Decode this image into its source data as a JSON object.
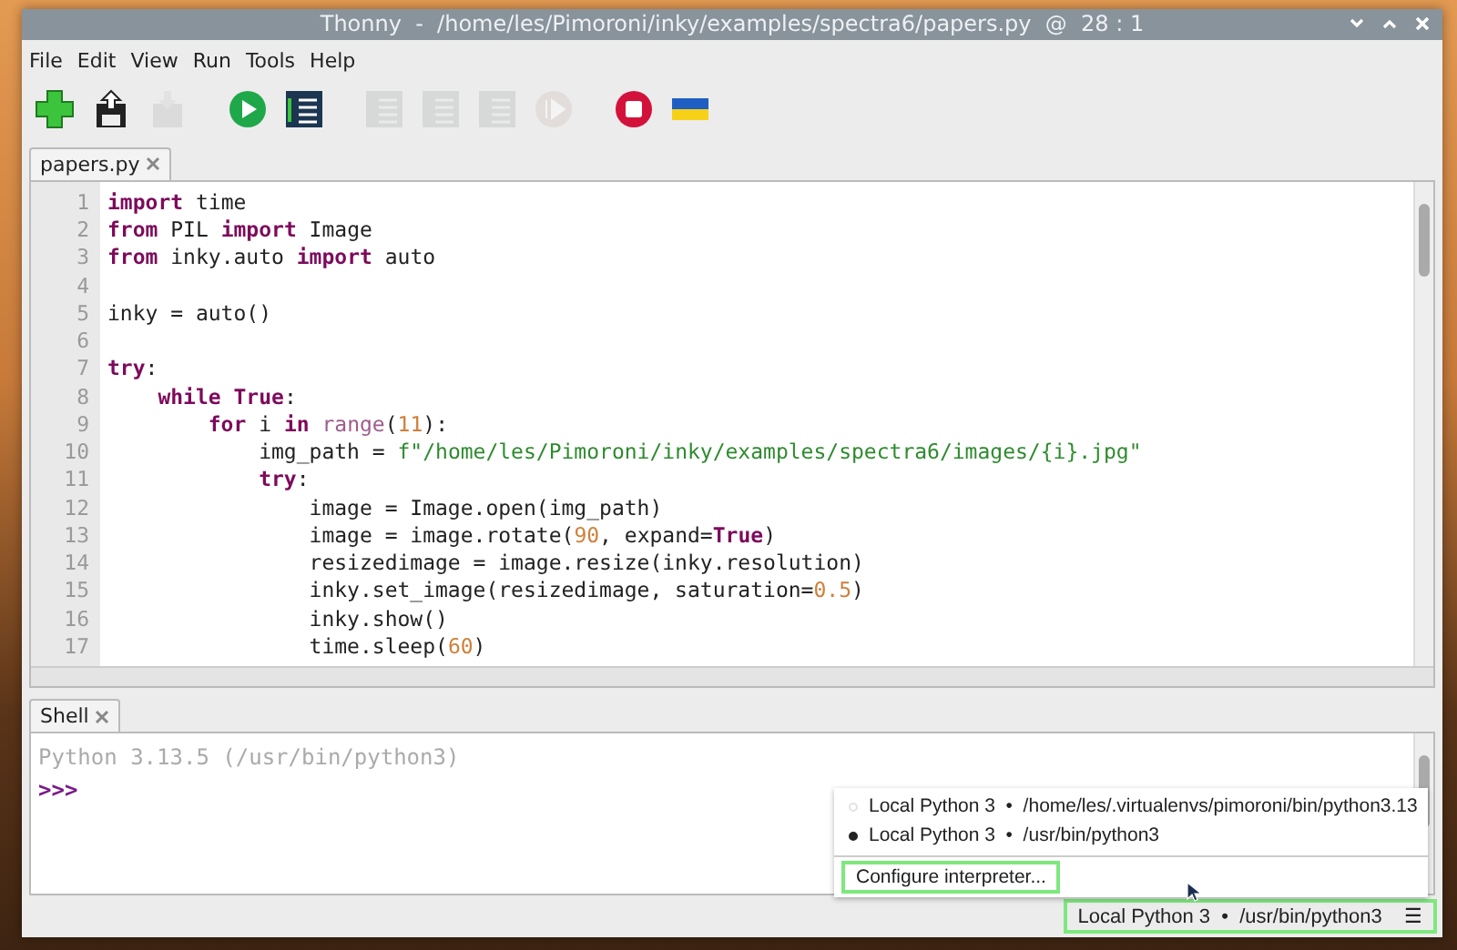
{
  "window": {
    "title": "Thonny  -  /home/les/Pimoroni/inky/examples/spectra6/papers.py  @  28 : 1"
  },
  "menu": [
    "File",
    "Edit",
    "View",
    "Run",
    "Tools",
    "Help"
  ],
  "toolbar": [
    {
      "kind": "new",
      "disabled": false
    },
    {
      "kind": "load",
      "disabled": false
    },
    {
      "kind": "save",
      "disabled": true
    },
    {
      "kind": "run",
      "disabled": false
    },
    {
      "kind": "debug",
      "disabled": false
    },
    {
      "kind": "step-over",
      "disabled": true
    },
    {
      "kind": "step-into",
      "disabled": true
    },
    {
      "kind": "step-out",
      "disabled": true
    },
    {
      "kind": "resume",
      "disabled": true
    },
    {
      "kind": "stop",
      "disabled": false
    },
    {
      "kind": "flag",
      "disabled": false
    }
  ],
  "editor": {
    "tabs": [
      {
        "label": "papers.py",
        "selected": true
      }
    ],
    "lines": [
      {
        "number": "1",
        "tokens": [
          {
            "kind": "kw",
            "text": "import"
          },
          {
            "kind": "plain",
            "text": " time"
          }
        ]
      },
      {
        "number": "2",
        "tokens": [
          {
            "kind": "kw",
            "text": "from"
          },
          {
            "kind": "plain",
            "text": " PIL "
          },
          {
            "kind": "kw",
            "text": "import"
          },
          {
            "kind": "plain",
            "text": " Image"
          }
        ]
      },
      {
        "number": "3",
        "tokens": [
          {
            "kind": "kw",
            "text": "from"
          },
          {
            "kind": "plain",
            "text": " inky.auto "
          },
          {
            "kind": "kw",
            "text": "import"
          },
          {
            "kind": "plain",
            "text": " auto"
          }
        ]
      },
      {
        "number": "4"
      },
      {
        "number": "5",
        "tokens": [
          {
            "kind": "plain",
            "text": "inky = auto()"
          }
        ]
      },
      {
        "number": "6"
      },
      {
        "number": "7",
        "tokens": [
          {
            "kind": "kw",
            "text": "try"
          },
          {
            "kind": "plain",
            "text": ":"
          }
        ]
      },
      {
        "number": "8",
        "tokens": [
          {
            "kind": "kw",
            "text": "    while True"
          },
          {
            "kind": "plain",
            "text": ":"
          }
        ]
      },
      {
        "number": "9",
        "tokens": [
          {
            "kind": "kw",
            "text": "        for"
          },
          {
            "kind": "plain",
            "text": " i "
          },
          {
            "kind": "kw",
            "text": "in"
          },
          {
            "kind": "builtin",
            "text": " range"
          },
          {
            "kind": "plain",
            "text": "("
          },
          {
            "kind": "num",
            "text": "11"
          },
          {
            "kind": "plain",
            "text": "):"
          }
        ]
      },
      {
        "number": "10",
        "tokens": [
          {
            "kind": "plain",
            "text": "            img_path = "
          },
          {
            "kind": "str",
            "text": "f\"/home/les/Pimoroni/inky/examples/spectra6/images/{i}.jpg\""
          }
        ]
      },
      {
        "number": "11",
        "tokens": [
          {
            "kind": "kw",
            "text": "            try"
          },
          {
            "kind": "plain",
            "text": ":"
          }
        ]
      },
      {
        "number": "12",
        "tokens": [
          {
            "kind": "plain",
            "text": "                image = Image.open(img_path)"
          }
        ]
      },
      {
        "number": "13",
        "tokens": [
          {
            "kind": "plain",
            "text": "                image = image.rotate("
          },
          {
            "kind": "num",
            "text": "90"
          },
          {
            "kind": "plain",
            "text": ", expand="
          },
          {
            "kind": "kw",
            "text": "True"
          },
          {
            "kind": "plain",
            "text": ")"
          }
        ]
      },
      {
        "number": "14",
        "tokens": [
          {
            "kind": "plain",
            "text": "                resizedimage = image.resize(inky.resolution)"
          }
        ]
      },
      {
        "number": "15",
        "tokens": [
          {
            "kind": "plain",
            "text": "                inky.set_image(resizedimage, saturation="
          },
          {
            "kind": "num",
            "text": "0.5"
          },
          {
            "kind": "plain",
            "text": ")"
          }
        ]
      },
      {
        "number": "16",
        "tokens": [
          {
            "kind": "plain",
            "text": "                inky.show()"
          }
        ]
      },
      {
        "number": "17",
        "tokens": [
          {
            "kind": "plain",
            "text": "                time.sleep("
          },
          {
            "kind": "num",
            "text": "60"
          },
          {
            "kind": "plain",
            "text": ")"
          }
        ]
      }
    ]
  },
  "shell": {
    "tabs": [
      {
        "label": "Shell",
        "selected": true
      }
    ],
    "lines": [
      {
        "kind": "info",
        "text": "Python 3.13.5 (/usr/bin/python3)"
      },
      {
        "kind": "prompt",
        "text": ">>>"
      }
    ]
  },
  "interpreter_menu": {
    "items": [
      {
        "label": "Local Python 3  •  /home/les/.virtualenvs/pimoroni/bin/python3.13",
        "selected": false
      },
      {
        "label": "Local Python 3  •  /usr/bin/python3",
        "selected": true
      }
    ],
    "configure": {
      "label": "Configure interpreter...",
      "highlighted": true
    }
  },
  "status_bar": {
    "interpreter": "Local Python 3  •  /usr/bin/python3",
    "menu_icon": "☰",
    "highlighted": true
  }
}
